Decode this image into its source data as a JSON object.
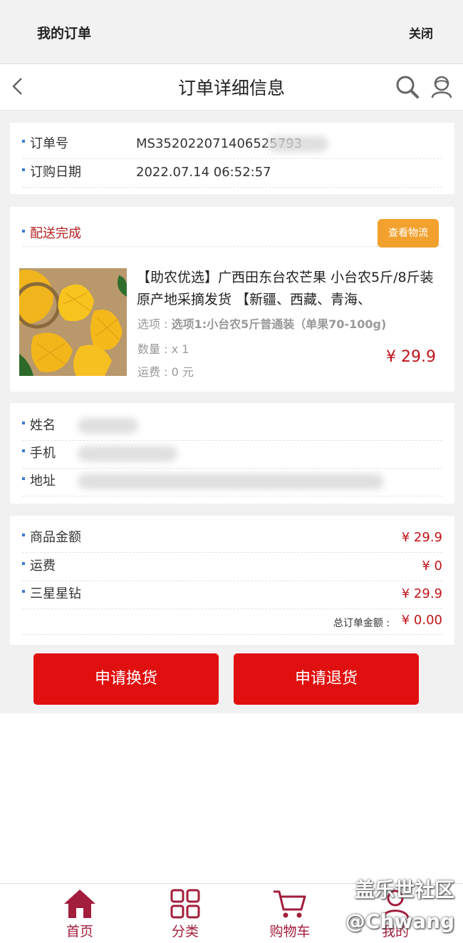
{
  "topbar": {
    "title": "我的订单",
    "close": "关闭"
  },
  "navbar": {
    "title": "订单详细信息"
  },
  "order": {
    "number_label": "订单号",
    "number": "MS352022071406525793",
    "date_label": "订购日期",
    "date": "2022.07.14 06:52:57"
  },
  "delivery": {
    "status": "配送完成",
    "track_button": "查看物流",
    "product": {
      "title": "【助农优选】广西田东台农芒果 小台农5斤/8斤装 原产地采摘发货 【新疆、西藏、青海、",
      "option_label": "选项 : ",
      "option_value": "选项1:小台农5斤普通装（单果70-100g)",
      "quantity": "数量 : x 1",
      "shipping": "运费 : 0 元",
      "price": "¥ 29.9"
    }
  },
  "buyer": {
    "name_label": "姓名",
    "phone_label": "手机",
    "address_label": "地址"
  },
  "payment": {
    "goods_label": "商品金额",
    "goods_value": "¥ 29.9",
    "shipping_label": "运费",
    "shipping_value": "¥ 0",
    "points_label": "三星星钻",
    "points_value": "¥ 29.9",
    "total_label": "总订单金额 :",
    "total_value": "¥ 0.00"
  },
  "actions": {
    "exchange": "申请换货",
    "refund": "申请退货"
  },
  "tabbar": {
    "home": "首页",
    "category": "分类",
    "cart": "购物车",
    "mine": "我的"
  },
  "watermark": {
    "line1": "盖乐世社区",
    "line2": "@Chwang"
  },
  "colors": {
    "accent_red": "#e11010",
    "price_red": "#c0141a",
    "track_orange": "#f2a12e",
    "tab_maroon": "#a31d3c"
  }
}
